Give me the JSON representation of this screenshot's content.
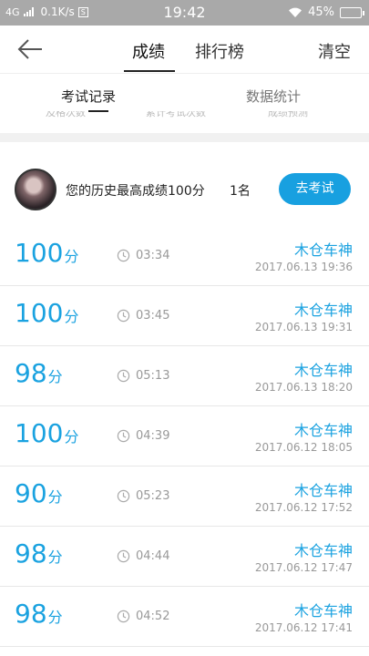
{
  "status_bar": {
    "network": "4G",
    "speed": "0.1K/s",
    "s_icon": "S",
    "time": "19:42",
    "battery": "45%",
    "battery_level": 0.45
  },
  "nav": {
    "tabs": [
      "成绩",
      "排行榜"
    ],
    "clear": "清空"
  },
  "subtabs": [
    "考试记录",
    "数据统计"
  ],
  "cut_labels": [
    "及格次数",
    "累计考试次数",
    "成绩预测"
  ],
  "best": {
    "text": "您的历史最高成绩100分",
    "rank": "1名",
    "button": "去考试"
  },
  "unit": "分",
  "records": [
    {
      "score": "100",
      "duration": "03:34",
      "name": "木仓车神",
      "date": "2017.06.13",
      "time": "19:36"
    },
    {
      "score": "100",
      "duration": "03:45",
      "name": "木仓车神",
      "date": "2017.06.13",
      "time": "19:31"
    },
    {
      "score": "98",
      "duration": "05:13",
      "name": "木仓车神",
      "date": "2017.06.13",
      "time": "18:20"
    },
    {
      "score": "100",
      "duration": "04:39",
      "name": "木仓车神",
      "date": "2017.06.12",
      "time": "18:05"
    },
    {
      "score": "90",
      "duration": "05:23",
      "name": "木仓车神",
      "date": "2017.06.12",
      "time": "17:52"
    },
    {
      "score": "98",
      "duration": "04:44",
      "name": "木仓车神",
      "date": "2017.06.12",
      "time": "17:47"
    },
    {
      "score": "98",
      "duration": "04:52",
      "name": "木仓车神",
      "date": "2017.06.12",
      "time": "17:41"
    }
  ]
}
